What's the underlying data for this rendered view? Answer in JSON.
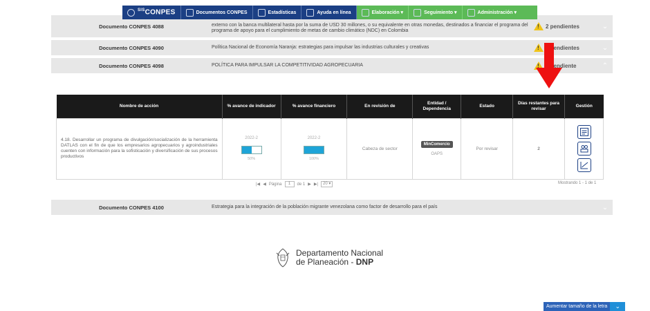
{
  "nav": {
    "logo_small": "SIS",
    "logo": "CONPES",
    "items": [
      {
        "label": "Documentos CONPES",
        "icon": "document-icon"
      },
      {
        "label": "Estadísticas",
        "icon": "stats-icon"
      },
      {
        "label": "Ayuda en línea",
        "icon": "help-icon"
      },
      {
        "label": "Elaboración ▾",
        "icon": "edit-icon"
      },
      {
        "label": "Seguimiento ▾",
        "icon": "tracking-icon"
      },
      {
        "label": "Administración ▾",
        "icon": "admin-icon"
      }
    ]
  },
  "documents": [
    {
      "name": "Documento CONPES 4088",
      "description": "externo con la banca multilateral hasta por la suma de USD 30 millones, o su equivalente en otras monedas, destinados a financiar el programa del programa de apoyo para el cumplimiento de metas de cambio climático (NDC) en Colombia",
      "pending": "2 pendientes"
    },
    {
      "name": "Documento CONPES 4090",
      "description": "Política Nacional de Economía Naranja: estrategias para impulsar las industrias culturales y creativas",
      "pending": "6 pendientes"
    },
    {
      "name": "Documento CONPES 4098",
      "description": "POLÍTICA PARA IMPULSAR LA COMPETITIVIDAD AGROPECUARIA",
      "pending": "1 pendiente"
    },
    {
      "name": "Documento CONPES 4100",
      "description": "Estrategia para la integración de la población migrante venezolana como factor de desarrollo para el país",
      "pending": ""
    }
  ],
  "table": {
    "headers": [
      "Nombre de acción",
      "% avance de indicador",
      "% avance financiero",
      "En revisión de",
      "Entidad / Dependencia",
      "Estado",
      "Días restantes para revisar",
      "Gestión"
    ],
    "rows": [
      {
        "action": "4.18. Desarrollar un programa de divulgación/socialización de la herramienta DATLAS con el fin de que los empresarios agropecuarios y agroindustriales cuenten con información para la sofisticación y diversificación de sus procesos productivos",
        "indicator_year": "2022-2",
        "indicator_pct_label": "50%",
        "indicator_fill": 0.5,
        "financial_year": "2022-2",
        "financial_pct_label": "100%",
        "financial_fill": 1.0,
        "review": "Cabeza de sector",
        "entity": "MinComercio",
        "dependency": "OAPS",
        "status": "Por revisar",
        "days": "2"
      }
    ]
  },
  "pager": {
    "page_label": "Página",
    "page_value": "1",
    "of_label": "de 1",
    "page_size": "20 ▾",
    "showing": "Mostrando 1 - 1 de 1"
  },
  "footer": {
    "line1": "Departamento Nacional",
    "line2_prefix": "de Planeación - ",
    "line2_bold": "DNP"
  },
  "font_button": {
    "label": "Aumentar tamaño de la letra"
  },
  "colors": {
    "nav": "#1b3f84",
    "nav_green": "#5cba57",
    "arrow": "#ee1111",
    "progress": "#1ea4d8"
  }
}
